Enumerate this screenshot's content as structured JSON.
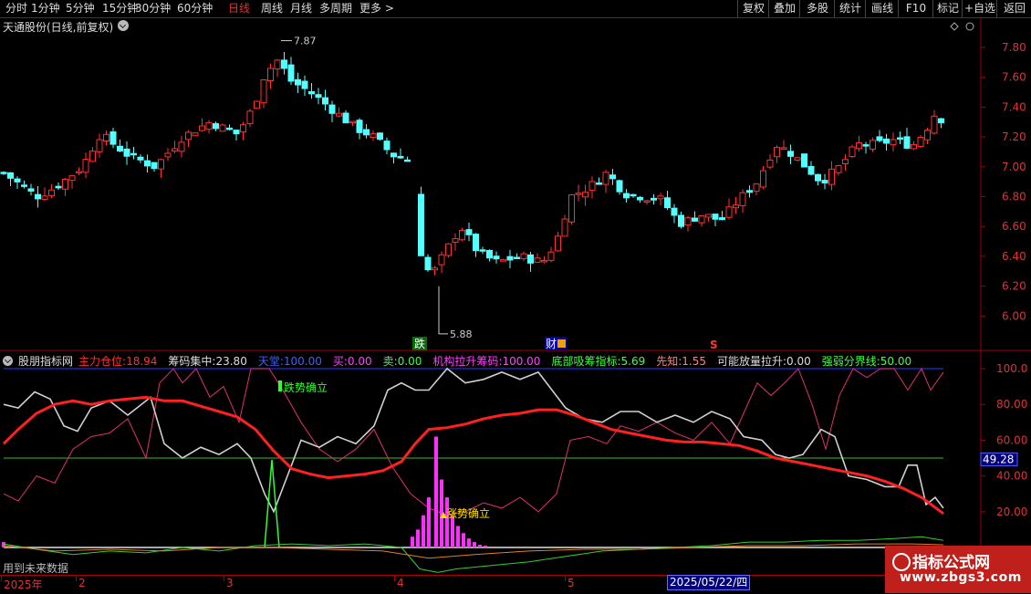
{
  "toolbar": {
    "periods": [
      "分时",
      "1分钟",
      "5分钟",
      "15分钟",
      "30分钟",
      "60分钟",
      "日线",
      "周线",
      "月线",
      "多周期",
      "更多 >"
    ],
    "active_period": "日线",
    "right_buttons": [
      "复权",
      "叠加",
      "多股",
      "统计",
      "画线",
      "F10",
      "标记",
      "+自选",
      "返回"
    ]
  },
  "main": {
    "title": "天通股份(日线,前复权)",
    "high_label": "7.87",
    "low_label": "5.88",
    "price_axis": [
      "7.80",
      "7.60",
      "7.40",
      "7.20",
      "7.00",
      "6.80",
      "6.60",
      "6.40",
      "6.20",
      "6.00"
    ],
    "markers": {
      "drop": "跌",
      "finance": "财",
      "s": "S"
    }
  },
  "indicator": {
    "name": "股朋指标网",
    "fields": [
      {
        "label": "主力仓位:",
        "value": "18.94",
        "color": "#ff3030"
      },
      {
        "label": "筹码集中:",
        "value": "23.80",
        "color": "#dddddd"
      },
      {
        "label": "天堂:",
        "value": "100.00",
        "color": "#4060ff"
      },
      {
        "label": "买:",
        "value": "0.00",
        "color": "#ff40ff"
      },
      {
        "label": "卖:",
        "value": "0.00",
        "color": "#40ff40"
      },
      {
        "label": "机构拉升筹码:",
        "value": "100.00",
        "color": "#ff40ff"
      },
      {
        "label": "底部吸筹指标:",
        "value": "5.69",
        "color": "#40ff40"
      },
      {
        "label": "先知:",
        "value": "1.55",
        "color": "#ff8080"
      },
      {
        "label": "可能放量拉升:",
        "value": "0.00",
        "color": "#dddddd"
      },
      {
        "label": "强弱分界线:",
        "value": "50.00",
        "color": "#40ff40"
      }
    ],
    "axis": [
      "100.0",
      "80.00",
      "60.00",
      "40.00",
      "20.00"
    ],
    "current_value": "49.28",
    "annotation_down": "跌势确立",
    "annotation_up": "涨势确立"
  },
  "future_note": "用到未来数据",
  "date_axis": {
    "labels": [
      "2025年",
      "2",
      "3",
      "4",
      "5"
    ],
    "cursor_date": "2025/05/22/四"
  },
  "watermark": {
    "title": "指标公式网",
    "url": "www.zbgs3.com"
  },
  "colors": {
    "up": "#ff3030",
    "down": "#54ffff",
    "axis": "#a00000",
    "magenta": "#ff30ff",
    "green": "#30ff30"
  }
}
